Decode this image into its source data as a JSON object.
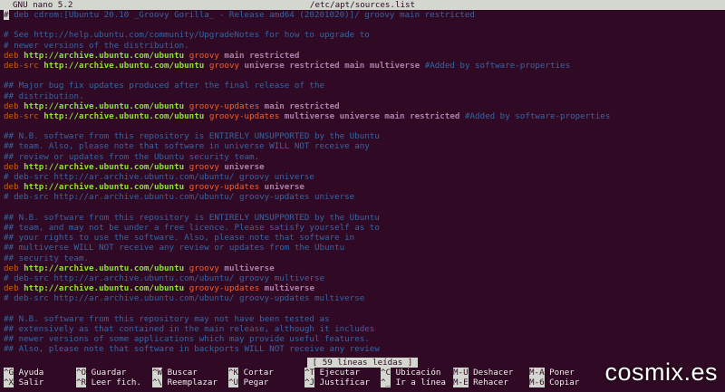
{
  "titlebar": {
    "app": "GNU nano 5.2",
    "file": "/etc/apt/sources.list"
  },
  "colors": {
    "background": "#300a24",
    "comment": "#3465a4",
    "deb": "#ce5c00",
    "url": "#8ae234",
    "dist": "#ef5f2f",
    "components": "#ad7fa8",
    "text": "#d3d7cf"
  },
  "editor": {
    "lines": [
      [
        [
          "cursor",
          "#"
        ],
        [
          "comment",
          " deb cdrom:[Ubuntu 20.10 _Groovy Gorilla_ - Release amd64 (20201020)]/ groovy main restricted"
        ]
      ],
      [],
      [
        [
          "comment",
          "# See http://help.ubuntu.com/community/UpgradeNotes for how to upgrade to"
        ]
      ],
      [
        [
          "comment",
          "# newer versions of the distribution."
        ]
      ],
      [
        [
          "deb",
          "deb "
        ],
        [
          "url",
          "http://archive.ubuntu.com/ubuntu "
        ],
        [
          "dist",
          "groovy "
        ],
        [
          "comp",
          "main restricted"
        ]
      ],
      [
        [
          "deb",
          "deb-src "
        ],
        [
          "url",
          "http://archive.ubuntu.com/ubuntu "
        ],
        [
          "dist",
          "groovy "
        ],
        [
          "comp",
          "universe restricted main multiverse "
        ],
        [
          "comment",
          "#Added by software-properties"
        ]
      ],
      [],
      [
        [
          "comment",
          "## Major bug fix updates produced after the final release of the"
        ]
      ],
      [
        [
          "comment",
          "## distribution."
        ]
      ],
      [
        [
          "deb",
          "deb "
        ],
        [
          "url",
          "http://archive.ubuntu.com/ubuntu "
        ],
        [
          "dist",
          "groovy-updates "
        ],
        [
          "comp",
          "main restricted"
        ]
      ],
      [
        [
          "deb",
          "deb-src "
        ],
        [
          "url",
          "http://archive.ubuntu.com/ubuntu "
        ],
        [
          "dist",
          "groovy-updates "
        ],
        [
          "comp",
          "multiverse universe main restricted "
        ],
        [
          "comment",
          "#Added by software-properties"
        ]
      ],
      [],
      [
        [
          "comment",
          "## N.B. software from this repository is ENTIRELY UNSUPPORTED by the Ubuntu"
        ]
      ],
      [
        [
          "comment",
          "## team. Also, please note that software in universe WILL NOT receive any"
        ]
      ],
      [
        [
          "comment",
          "## review or updates from the Ubuntu security team."
        ]
      ],
      [
        [
          "deb",
          "deb "
        ],
        [
          "url",
          "http://archive.ubuntu.com/ubuntu "
        ],
        [
          "dist",
          "groovy "
        ],
        [
          "comp",
          "universe"
        ]
      ],
      [
        [
          "comment",
          "# deb-src http://ar.archive.ubuntu.com/ubuntu/ groovy universe"
        ]
      ],
      [
        [
          "deb",
          "deb "
        ],
        [
          "url",
          "http://archive.ubuntu.com/ubuntu "
        ],
        [
          "dist",
          "groovy-updates "
        ],
        [
          "comp",
          "universe"
        ]
      ],
      [
        [
          "comment",
          "# deb-src http://ar.archive.ubuntu.com/ubuntu/ groovy-updates universe"
        ]
      ],
      [],
      [
        [
          "comment",
          "## N.B. software from this repository is ENTIRELY UNSUPPORTED by the Ubuntu"
        ]
      ],
      [
        [
          "comment",
          "## team, and may not be under a free licence. Please satisfy yourself as to"
        ]
      ],
      [
        [
          "comment",
          "## your rights to use the software. Also, please note that software in"
        ]
      ],
      [
        [
          "comment",
          "## multiverse WILL NOT receive any review or updates from the Ubuntu"
        ]
      ],
      [
        [
          "comment",
          "## security team."
        ]
      ],
      [
        [
          "deb",
          "deb "
        ],
        [
          "url",
          "http://archive.ubuntu.com/ubuntu "
        ],
        [
          "dist",
          "groovy "
        ],
        [
          "comp",
          "multiverse"
        ]
      ],
      [
        [
          "comment",
          "# deb-src http://ar.archive.ubuntu.com/ubuntu/ groovy multiverse"
        ]
      ],
      [
        [
          "deb",
          "deb "
        ],
        [
          "url",
          "http://archive.ubuntu.com/ubuntu "
        ],
        [
          "dist",
          "groovy-updates "
        ],
        [
          "comp",
          "multiverse"
        ]
      ],
      [
        [
          "comment",
          "# deb-src http://ar.archive.ubuntu.com/ubuntu/ groovy-updates multiverse"
        ]
      ],
      [],
      [
        [
          "comment",
          "## N.B. software from this repository may not have been tested as"
        ]
      ],
      [
        [
          "comment",
          "## extensively as that contained in the main release, although it includes"
        ]
      ],
      [
        [
          "comment",
          "## newer versions of some applications which may provide useful features."
        ]
      ],
      [
        [
          "comment",
          "## Also, please note that software in backports WILL NOT receive any review"
        ]
      ]
    ]
  },
  "status": "[ 59 líneas leídas ]",
  "shortcuts": [
    {
      "key": "^G",
      "label": "Ayuda"
    },
    {
      "key": "^X",
      "label": "Salir"
    },
    {
      "key": "^O",
      "label": "Guardar"
    },
    {
      "key": "^R",
      "label": "Leer fich."
    },
    {
      "key": "^W",
      "label": "Buscar"
    },
    {
      "key": "^\\",
      "label": "Reemplazar"
    },
    {
      "key": "^K",
      "label": "Cortar"
    },
    {
      "key": "^U",
      "label": "Pegar"
    },
    {
      "key": "^T",
      "label": "Ejecutar"
    },
    {
      "key": "^J",
      "label": "Justificar"
    },
    {
      "key": "^C",
      "label": "Ubicación"
    },
    {
      "key": "^_",
      "label": "Ir a línea"
    },
    {
      "key": "M-U",
      "label": "Deshacer"
    },
    {
      "key": "M-E",
      "label": "Rehacer"
    },
    {
      "key": "M-A",
      "label": "Poner"
    },
    {
      "key": "M-6",
      "label": "Copiar"
    }
  ],
  "watermark": "cosmix.es"
}
